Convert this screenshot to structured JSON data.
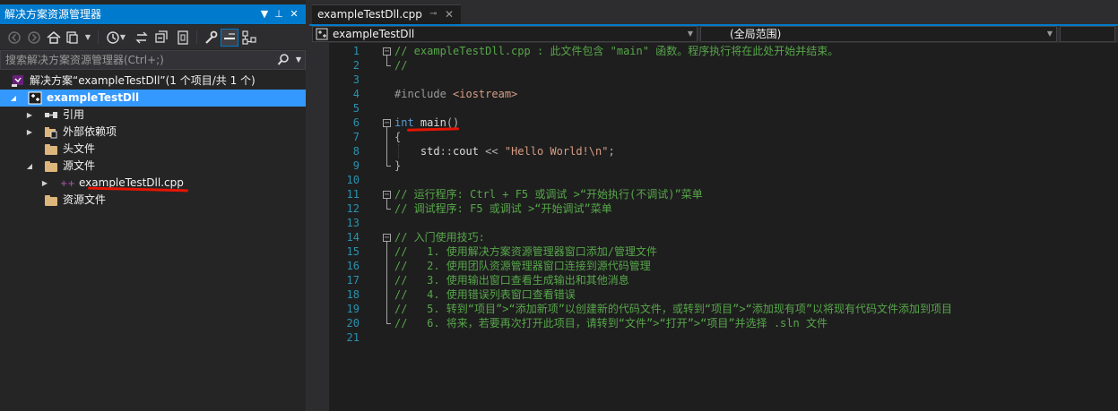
{
  "solution_explorer": {
    "title": "解决方案资源管理器",
    "title_buttons": [
      "▼",
      "⊥",
      "✕"
    ],
    "search_placeholder": "搜索解决方案资源管理器(Ctrl+;)",
    "solution_label": "解决方案“exampleTestDll”(1 个项目/共 1 个)",
    "project_label": "exampleTestDll",
    "items": [
      {
        "label": "引用",
        "icon": "references-icon",
        "expandable": true,
        "expanded": false
      },
      {
        "label": "外部依赖项",
        "icon": "external-deps-icon",
        "expandable": true,
        "expanded": false
      },
      {
        "label": "头文件",
        "icon": "folder-icon",
        "expandable": false,
        "expanded": false
      },
      {
        "label": "源文件",
        "icon": "folder-icon",
        "expandable": true,
        "expanded": true
      },
      {
        "label": "exampleTestDll.cpp",
        "icon": "cpp-file-icon",
        "expandable": true,
        "expanded": false
      },
      {
        "label": "资源文件",
        "icon": "folder-icon",
        "expandable": false,
        "expanded": false
      }
    ],
    "toolbar_icons": [
      "back-icon",
      "forward-icon",
      "home-icon",
      "switch-views-icon",
      "history-icon",
      "sync-icon",
      "collapse-all-icon",
      "show-all-files-icon",
      "properties-icon",
      "preview-icon",
      "class-view-icon"
    ]
  },
  "editor": {
    "tab_title": "exampleTestDll.cpp",
    "tab_pin": "⊸",
    "tab_close": "✕",
    "nav_project": "exampleTestDll",
    "nav_scope": "(全局范围)",
    "lines": [
      [
        [
          "com",
          "// exampleTestDll.cpp : 此文件包含 \"main\" 函数。程序执行将在此处开始并结束。"
        ]
      ],
      [
        [
          "com",
          "//"
        ]
      ],
      [],
      [
        [
          "pp",
          "#include "
        ],
        [
          "str",
          "<iostream>"
        ]
      ],
      [],
      [
        [
          "kw",
          "int"
        ],
        [
          "id",
          " main"
        ],
        [
          "op",
          "()"
        ]
      ],
      [
        [
          "op",
          "{"
        ]
      ],
      [
        [
          "id",
          "    std"
        ],
        [
          "op",
          "::"
        ],
        [
          "id",
          "cout "
        ],
        [
          "op",
          "<< "
        ],
        [
          "str",
          "\"Hello World!\\n\""
        ],
        [
          "op",
          ";"
        ]
      ],
      [
        [
          "op",
          "}"
        ]
      ],
      [],
      [
        [
          "com",
          "// 运行程序: Ctrl + F5 或调试 >“开始执行(不调试)”菜单"
        ]
      ],
      [
        [
          "com",
          "// 调试程序: F5 或调试 >“开始调试”菜单"
        ]
      ],
      [],
      [
        [
          "com",
          "// 入门使用技巧:"
        ]
      ],
      [
        [
          "com",
          "//   1. 使用解决方案资源管理器窗口添加/管理文件"
        ]
      ],
      [
        [
          "com",
          "//   2. 使用团队资源管理器窗口连接到源代码管理"
        ]
      ],
      [
        [
          "com",
          "//   3. 使用输出窗口查看生成输出和其他消息"
        ]
      ],
      [
        [
          "com",
          "//   4. 使用错误列表窗口查看错误"
        ]
      ],
      [
        [
          "com",
          "//   5. 转到“项目”>“添加新项”以创建新的代码文件，或转到“项目”>“添加现有项”以将现有代码文件添加到项目"
        ]
      ],
      [
        [
          "com",
          "//   6. 将来，若要再次打开此项目，请转到“文件”>“打开”>“项目”并选择 .sln 文件"
        ]
      ],
      []
    ]
  },
  "colors": {
    "accent": "#007acc",
    "selection": "#3399ff",
    "comment": "#57a64a",
    "keyword": "#569cd6",
    "string": "#d69d85",
    "line_number": "#2b91af",
    "annotation_red": "#e51400"
  }
}
